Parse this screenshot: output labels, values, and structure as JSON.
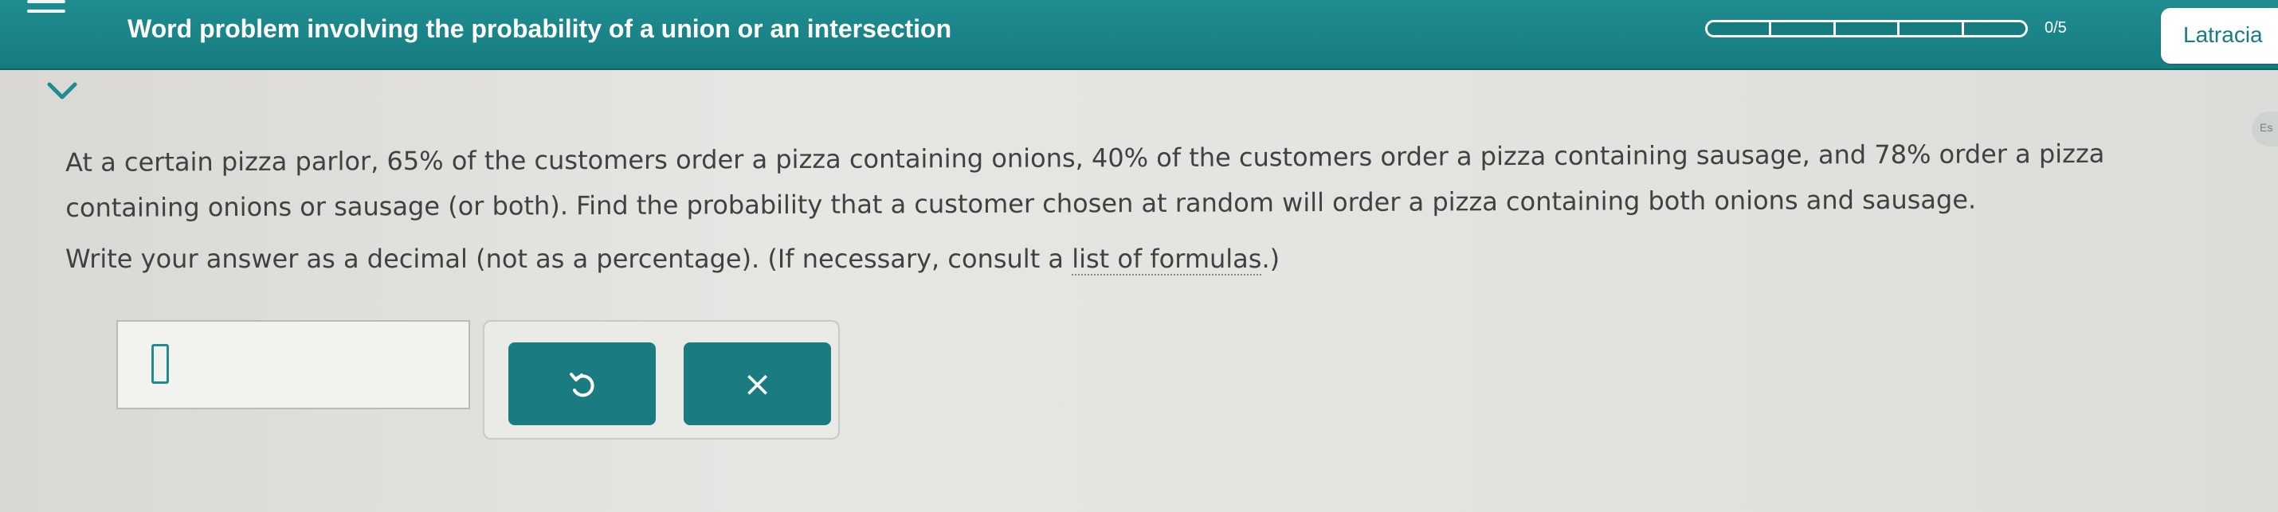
{
  "header": {
    "title": "Word problem involving the probability of a union or an intersection",
    "progress_text": "0/5",
    "progress": 0,
    "progress_segments": 5,
    "user_name": "Latracia"
  },
  "edge_tab": {
    "label": "Es"
  },
  "question": {
    "text": "At a certain pizza parlor, 65% of the customers order a pizza containing onions, 40% of the customers order a pizza containing sausage, and 78% order a pizza containing onions or sausage (or both). Find the probability that a customer chosen at random will order a pizza containing both onions and sausage.",
    "instruction_prefix": "Write your answer as a decimal (not as a percentage). (If necessary, consult a ",
    "link_text": "list of formulas",
    "instruction_suffix": ".)"
  },
  "answer": {
    "value": "",
    "undo_label": "↺",
    "clear_label": "×"
  },
  "colors": {
    "teal": "#167c80",
    "text": "#3f4340"
  }
}
